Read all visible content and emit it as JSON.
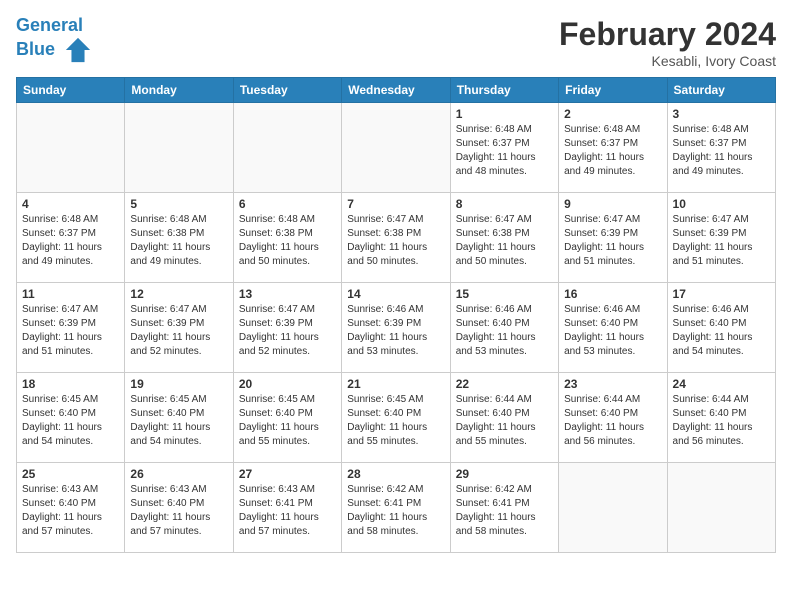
{
  "header": {
    "logo_line1": "General",
    "logo_line2": "Blue",
    "month_year": "February 2024",
    "location": "Kesabli, Ivory Coast"
  },
  "days_of_week": [
    "Sunday",
    "Monday",
    "Tuesday",
    "Wednesday",
    "Thursday",
    "Friday",
    "Saturday"
  ],
  "weeks": [
    [
      {
        "day": "",
        "empty": true
      },
      {
        "day": "",
        "empty": true
      },
      {
        "day": "",
        "empty": true
      },
      {
        "day": "",
        "empty": true
      },
      {
        "day": "1",
        "sunrise": "6:48 AM",
        "sunset": "6:37 PM",
        "daylight": "11 hours and 48 minutes."
      },
      {
        "day": "2",
        "sunrise": "6:48 AM",
        "sunset": "6:37 PM",
        "daylight": "11 hours and 49 minutes."
      },
      {
        "day": "3",
        "sunrise": "6:48 AM",
        "sunset": "6:37 PM",
        "daylight": "11 hours and 49 minutes."
      }
    ],
    [
      {
        "day": "4",
        "sunrise": "6:48 AM",
        "sunset": "6:37 PM",
        "daylight": "11 hours and 49 minutes."
      },
      {
        "day": "5",
        "sunrise": "6:48 AM",
        "sunset": "6:38 PM",
        "daylight": "11 hours and 49 minutes."
      },
      {
        "day": "6",
        "sunrise": "6:48 AM",
        "sunset": "6:38 PM",
        "daylight": "11 hours and 50 minutes."
      },
      {
        "day": "7",
        "sunrise": "6:47 AM",
        "sunset": "6:38 PM",
        "daylight": "11 hours and 50 minutes."
      },
      {
        "day": "8",
        "sunrise": "6:47 AM",
        "sunset": "6:38 PM",
        "daylight": "11 hours and 50 minutes."
      },
      {
        "day": "9",
        "sunrise": "6:47 AM",
        "sunset": "6:39 PM",
        "daylight": "11 hours and 51 minutes."
      },
      {
        "day": "10",
        "sunrise": "6:47 AM",
        "sunset": "6:39 PM",
        "daylight": "11 hours and 51 minutes."
      }
    ],
    [
      {
        "day": "11",
        "sunrise": "6:47 AM",
        "sunset": "6:39 PM",
        "daylight": "11 hours and 51 minutes."
      },
      {
        "day": "12",
        "sunrise": "6:47 AM",
        "sunset": "6:39 PM",
        "daylight": "11 hours and 52 minutes."
      },
      {
        "day": "13",
        "sunrise": "6:47 AM",
        "sunset": "6:39 PM",
        "daylight": "11 hours and 52 minutes."
      },
      {
        "day": "14",
        "sunrise": "6:46 AM",
        "sunset": "6:39 PM",
        "daylight": "11 hours and 53 minutes."
      },
      {
        "day": "15",
        "sunrise": "6:46 AM",
        "sunset": "6:40 PM",
        "daylight": "11 hours and 53 minutes."
      },
      {
        "day": "16",
        "sunrise": "6:46 AM",
        "sunset": "6:40 PM",
        "daylight": "11 hours and 53 minutes."
      },
      {
        "day": "17",
        "sunrise": "6:46 AM",
        "sunset": "6:40 PM",
        "daylight": "11 hours and 54 minutes."
      }
    ],
    [
      {
        "day": "18",
        "sunrise": "6:45 AM",
        "sunset": "6:40 PM",
        "daylight": "11 hours and 54 minutes."
      },
      {
        "day": "19",
        "sunrise": "6:45 AM",
        "sunset": "6:40 PM",
        "daylight": "11 hours and 54 minutes."
      },
      {
        "day": "20",
        "sunrise": "6:45 AM",
        "sunset": "6:40 PM",
        "daylight": "11 hours and 55 minutes."
      },
      {
        "day": "21",
        "sunrise": "6:45 AM",
        "sunset": "6:40 PM",
        "daylight": "11 hours and 55 minutes."
      },
      {
        "day": "22",
        "sunrise": "6:44 AM",
        "sunset": "6:40 PM",
        "daylight": "11 hours and 55 minutes."
      },
      {
        "day": "23",
        "sunrise": "6:44 AM",
        "sunset": "6:40 PM",
        "daylight": "11 hours and 56 minutes."
      },
      {
        "day": "24",
        "sunrise": "6:44 AM",
        "sunset": "6:40 PM",
        "daylight": "11 hours and 56 minutes."
      }
    ],
    [
      {
        "day": "25",
        "sunrise": "6:43 AM",
        "sunset": "6:40 PM",
        "daylight": "11 hours and 57 minutes."
      },
      {
        "day": "26",
        "sunrise": "6:43 AM",
        "sunset": "6:40 PM",
        "daylight": "11 hours and 57 minutes."
      },
      {
        "day": "27",
        "sunrise": "6:43 AM",
        "sunset": "6:41 PM",
        "daylight": "11 hours and 57 minutes."
      },
      {
        "day": "28",
        "sunrise": "6:42 AM",
        "sunset": "6:41 PM",
        "daylight": "11 hours and 58 minutes."
      },
      {
        "day": "29",
        "sunrise": "6:42 AM",
        "sunset": "6:41 PM",
        "daylight": "11 hours and 58 minutes."
      },
      {
        "day": "",
        "empty": true
      },
      {
        "day": "",
        "empty": true
      }
    ]
  ]
}
